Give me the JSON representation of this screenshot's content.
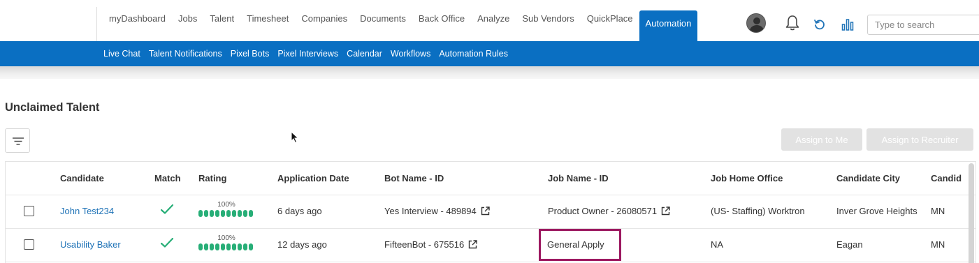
{
  "topnav": {
    "items": [
      "myDashboard",
      "Jobs",
      "Talent",
      "Timesheet",
      "Companies",
      "Documents",
      "Back Office",
      "Analyze",
      "Sub Vendors",
      "QuickPlace",
      "Automation"
    ],
    "active": "Automation"
  },
  "search": {
    "placeholder": "Type to search"
  },
  "subnav": {
    "items": [
      "Live Chat",
      "Talent Notifications",
      "Pixel Bots",
      "Pixel Interviews",
      "Calendar",
      "Workflows",
      "Automation Rules"
    ]
  },
  "page": {
    "title": "Unclaimed Talent",
    "assign_me_label": "Assign to Me",
    "assign_recruiter_label": "Assign to Recruiter"
  },
  "table": {
    "headers": [
      "Candidate",
      "Match",
      "Rating",
      "Application Date",
      "Bot Name - ID",
      "Job Name - ID",
      "Job Home Office",
      "Candidate City",
      "Candid"
    ],
    "rows": [
      {
        "candidate": "John Test234",
        "rating_pct": "100%",
        "rating_value": 1.0,
        "application_date": "6 days ago",
        "bot": "Yes Interview - 489894",
        "job": "Product Owner - 26080571",
        "home_office": "(US- Staffing) Worktron",
        "city": "Inver Grove Heights",
        "state": "MN"
      },
      {
        "candidate": "Usability Baker",
        "rating_pct": "100%",
        "rating_value": 1.0,
        "application_date": "12 days ago",
        "bot": "FifteenBot - 675516",
        "job": "General Apply",
        "home_office": "NA",
        "city": "Eagan",
        "state": "MN"
      }
    ]
  },
  "colors": {
    "primary": "#0a6fc2",
    "match_green": "#27ae77",
    "highlight": "#9c1860",
    "link": "#1f73b7"
  }
}
